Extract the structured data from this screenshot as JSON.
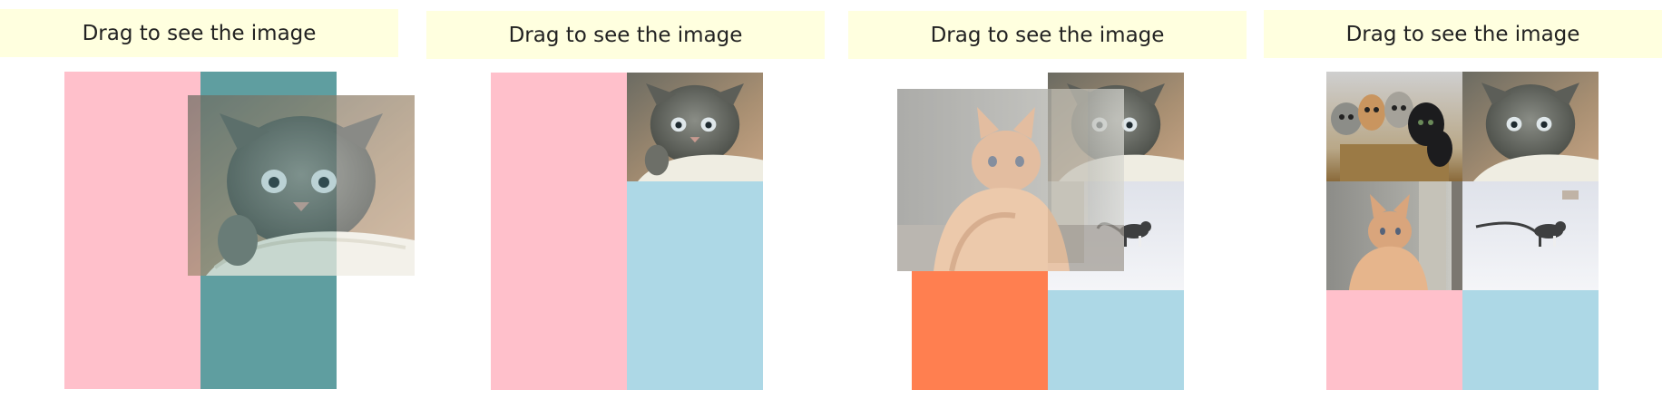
{
  "headers": [
    {
      "text": "Drag to see the image"
    },
    {
      "text": "Drag to see the image"
    },
    {
      "text": "Drag to see the image"
    },
    {
      "text": "Drag to see the image"
    }
  ],
  "colors": {
    "pink": "#ffc0cb",
    "teal": "#5f9ea0",
    "light_blue": "#add8e6",
    "coral": "#ff7f50",
    "header_bg": "#ffffdf"
  },
  "images": {
    "grey_kitten": "grey-kitten-photo",
    "orange_cat": "orange-cat-photo",
    "snow_cat": "snow-cat-photo",
    "kittens_group": "kittens-in-basket-photo"
  }
}
